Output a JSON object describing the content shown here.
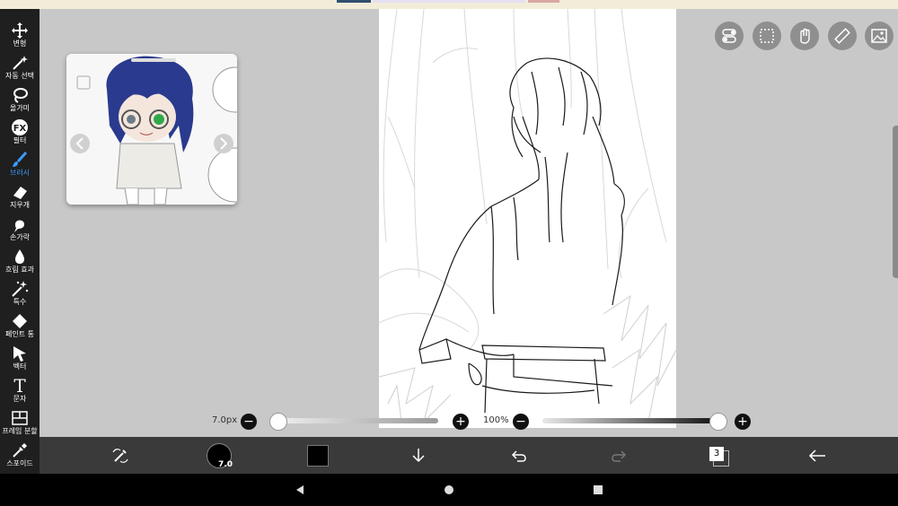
{
  "toolbar": {
    "items": [
      {
        "icon": "move-icon",
        "label": "변형"
      },
      {
        "icon": "magic-wand-icon",
        "label": "자동 선택"
      },
      {
        "icon": "lasso-icon",
        "label": "올가미"
      },
      {
        "icon": "fx-icon",
        "label": "필터"
      },
      {
        "icon": "brush-icon",
        "label": "브러시",
        "active": true
      },
      {
        "icon": "eraser-icon",
        "label": "지우개"
      },
      {
        "icon": "finger-icon",
        "label": "손가락"
      },
      {
        "icon": "drop-icon",
        "label": "흐림 효과"
      },
      {
        "icon": "sparkle-icon",
        "label": "특수"
      },
      {
        "icon": "paint-bucket-icon",
        "label": "페인트 통"
      },
      {
        "icon": "cursor-icon",
        "label": "벡터"
      },
      {
        "icon": "text-icon",
        "label": "문자"
      },
      {
        "icon": "frame-split-icon",
        "label": "프레임 분할"
      },
      {
        "icon": "eyedropper-icon",
        "label": "스포이드"
      }
    ]
  },
  "fx_glyph": "FX",
  "text_glyph": "T",
  "sliders": {
    "brush_size": "7.0px",
    "opacity": "100%",
    "minus": "−",
    "plus": "+",
    "brush_size_fraction": 0.0,
    "opacity_fraction": 1.0
  },
  "bottom": {
    "brush_value": "7.0",
    "layer_count": "3",
    "color": "#000000"
  },
  "colors": {
    "toolbar_bg": "#1f1f1f",
    "bottom_bg": "#3a3a3a",
    "canvas_bg": "#c8c8c8",
    "accent": "#3b9bff"
  },
  "top_icons": [
    "toggle-icon",
    "selection-icon",
    "hand-icon",
    "ruler-icon",
    "image-icon"
  ],
  "nav": [
    "back-icon",
    "home-icon",
    "recents-icon"
  ]
}
